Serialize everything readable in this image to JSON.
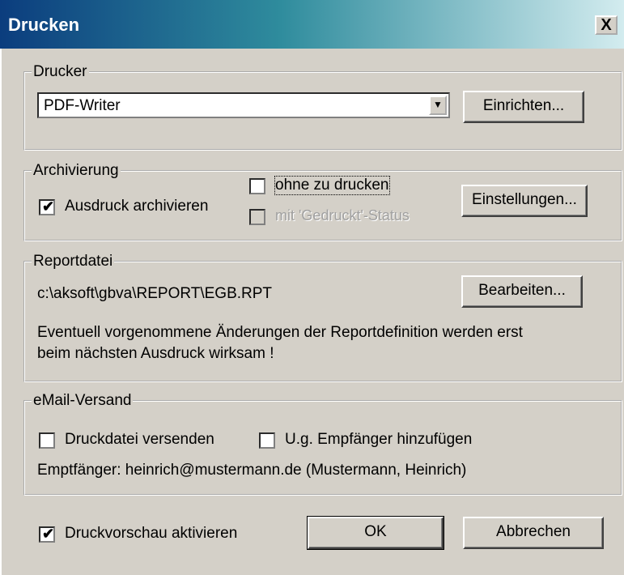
{
  "window": {
    "title": "Drucken",
    "close_label": "X"
  },
  "printer": {
    "group_label": "Drucker",
    "selected": "PDF-Writer",
    "setup_button": "Einrichten..."
  },
  "archive": {
    "group_label": "Archivierung",
    "archive_print_label": "Ausdruck archivieren",
    "archive_print_checked": true,
    "without_print_label": "ohne zu drucken",
    "without_print_checked": false,
    "printed_status_label": "mit 'Gedruckt'-Status",
    "printed_status_checked": false,
    "printed_status_enabled": false,
    "settings_button": "Einstellungen..."
  },
  "report": {
    "group_label": "Reportdatei",
    "path": "c:\\aksoft\\gbva\\REPORT\\EGB.RPT",
    "edit_button": "Bearbeiten...",
    "note_line1": "Eventuell vorgenommene Änderungen der Reportdefinition werden erst",
    "note_line2": "beim nächsten Ausdruck wirksam !"
  },
  "email": {
    "group_label": "eMail-Versand",
    "send_file_label": "Druckdatei versenden",
    "send_file_checked": false,
    "add_recipient_label": "U.g. Empfänger hinzufügen",
    "add_recipient_checked": false,
    "recipient_text": "Emptfänger: heinrich@mustermann.de (Mustermann, Heinrich)"
  },
  "footer": {
    "preview_label": "Druckvorschau aktivieren",
    "preview_checked": true,
    "ok_button": "OK",
    "cancel_button": "Abbrechen"
  }
}
